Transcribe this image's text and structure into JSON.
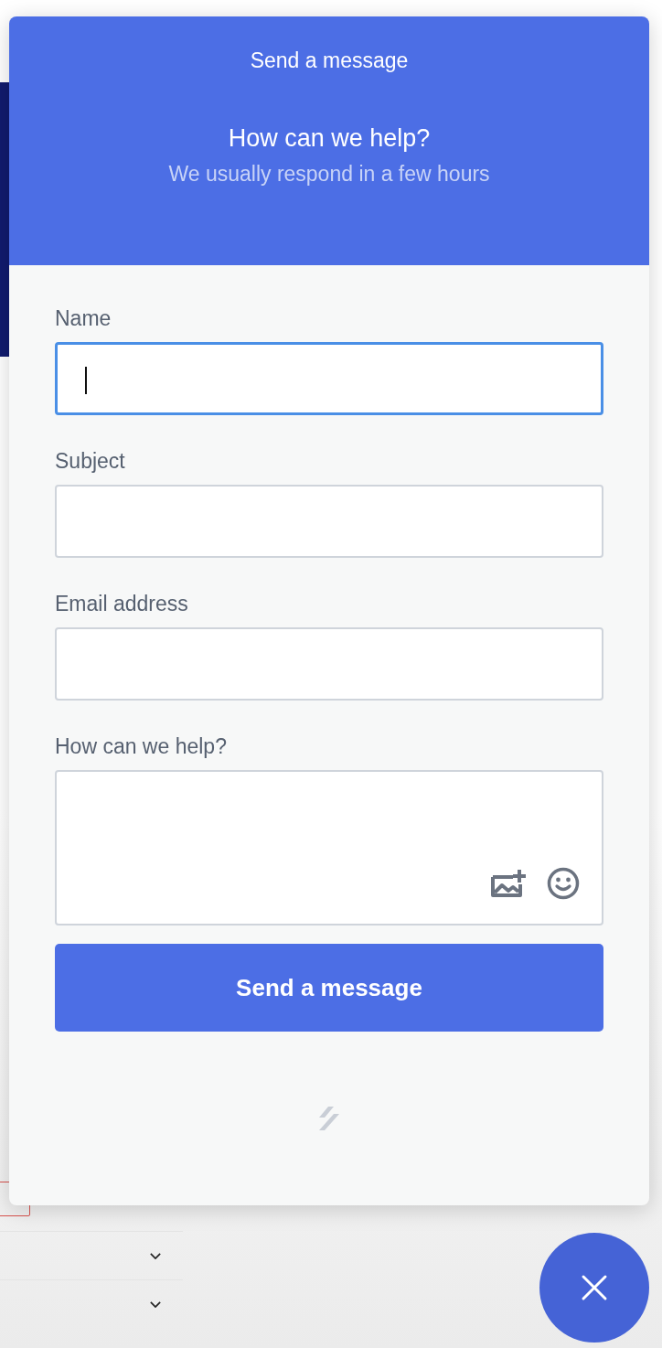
{
  "widget": {
    "title": "Send a message",
    "heading": "How can we help?",
    "subheading": "We usually respond in a few hours",
    "fields": [
      {
        "kind": "input",
        "label": "Name",
        "focused": true
      },
      {
        "kind": "input",
        "label": "Subject",
        "focused": false
      },
      {
        "kind": "input",
        "label": "Email address",
        "focused": false
      },
      {
        "kind": "textarea",
        "label": "How can we help?",
        "focused": false
      }
    ],
    "submit": "Send a message"
  }
}
